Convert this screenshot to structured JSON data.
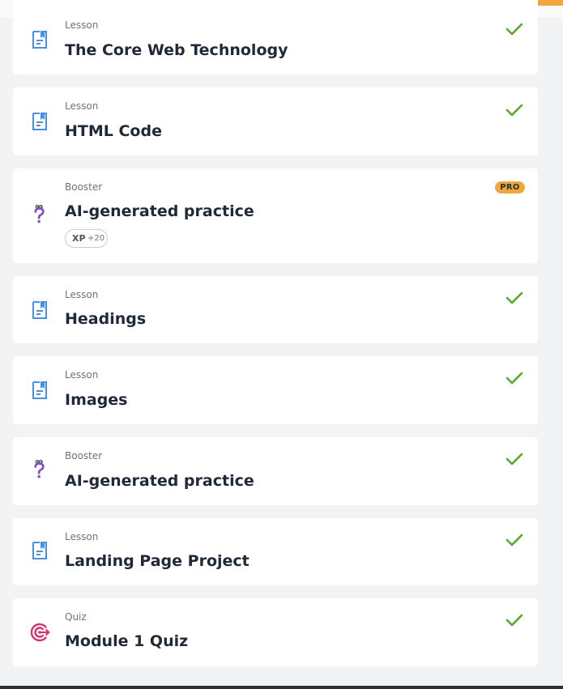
{
  "items": [
    {
      "type": "Lesson",
      "title": "The Core Web Technology",
      "icon": "lesson-document-icon",
      "status": "completed"
    },
    {
      "type": "Lesson",
      "title": "HTML Code",
      "icon": "lesson-document-icon",
      "status": "completed"
    },
    {
      "type": "Booster",
      "title": "AI-generated practice",
      "icon": "question-mark-icon",
      "badge": "PRO",
      "xp_label": "XP",
      "xp_amount": "+20"
    },
    {
      "type": "Lesson",
      "title": "Headings",
      "icon": "lesson-document-icon",
      "status": "completed"
    },
    {
      "type": "Lesson",
      "title": "Images",
      "icon": "lesson-document-icon",
      "status": "completed"
    },
    {
      "type": "Booster",
      "title": "AI-generated practice",
      "icon": "question-mark-icon",
      "status": "completed"
    },
    {
      "type": "Lesson",
      "title": "Landing Page Project",
      "icon": "lesson-document-icon",
      "status": "completed"
    },
    {
      "type": "Quiz",
      "title": "Module 1 Quiz",
      "icon": "target-icon",
      "status": "completed"
    }
  ],
  "colors": {
    "accent": "#f0a83e",
    "check": "#5aa832",
    "lesson_icon": "#4a90e2",
    "booster_icon": "#7c4dcc",
    "quiz_icon": "#d6336c",
    "title_text": "#1f2937",
    "type_text": "#6b7280",
    "background": "#f2f3f5",
    "card": "#ffffff"
  }
}
